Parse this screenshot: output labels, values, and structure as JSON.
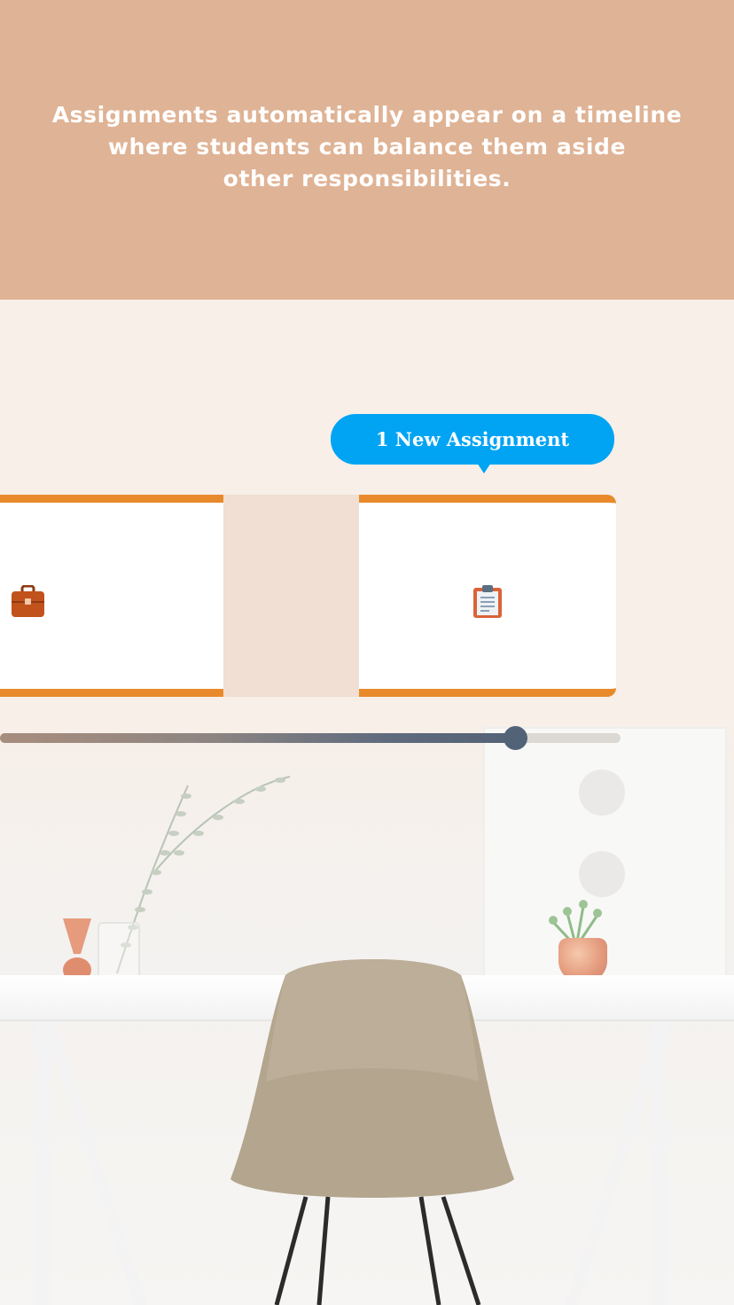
{
  "header": {
    "lines": [
      "Assignments automatically appear on a timeline",
      "where students can balance them aside",
      "other responsibilities."
    ]
  },
  "timeline": {
    "tooltip_text": "1 New Assignment",
    "left_card_icon": "briefcase-icon",
    "right_card_icon": "clipboard-icon",
    "progress_fraction": 0.83
  },
  "colors": {
    "header_bg": "#dfb395",
    "accent_orange": "#e88a2b",
    "tooltip_blue": "#00a4f3",
    "slider_thumb": "#526378",
    "page_bg": "#f7efe8"
  }
}
